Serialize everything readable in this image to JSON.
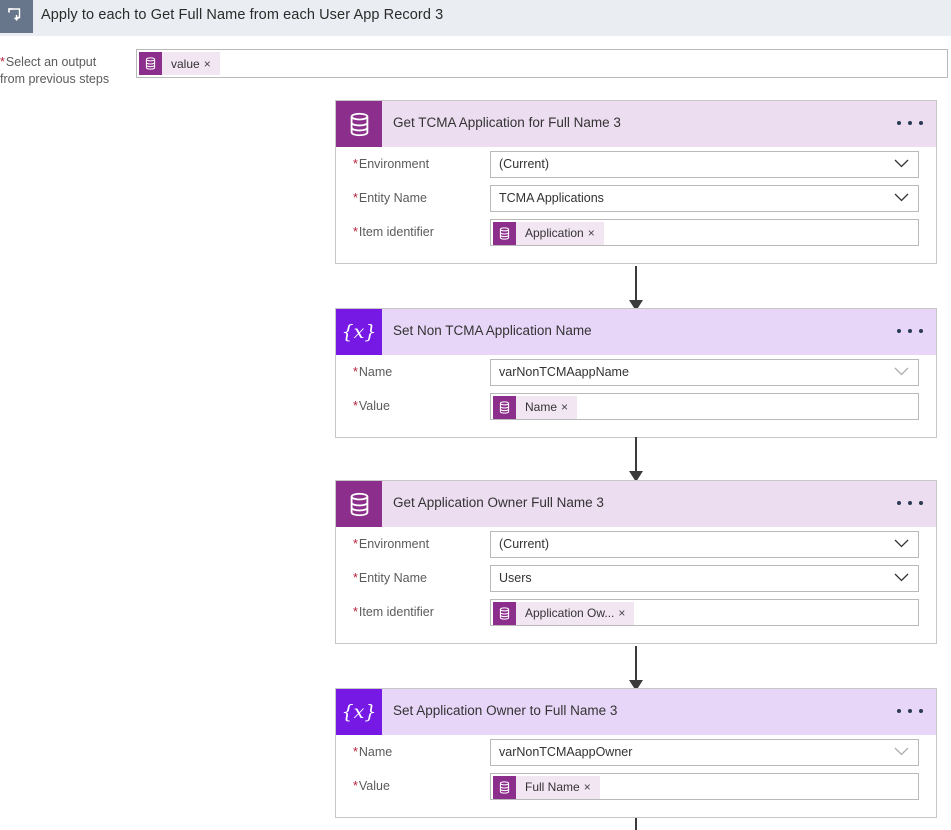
{
  "header": {
    "icon": "loop-repeat-icon",
    "title": "Apply to each to Get Full Name from each User App Record 3"
  },
  "output_selector": {
    "label_line1": "Select an output",
    "label_line2": "from previous steps",
    "required_mark": "*",
    "token": {
      "text": "value",
      "remove": "×",
      "icon": "database-icon"
    }
  },
  "colors": {
    "header_bar": "#eaedf1",
    "header_tile": "#67768a",
    "action_header": "#ecddf0",
    "action_icon": "#8c2f8c",
    "variable_header": "#e7d6f8",
    "variable_icon": "#7719e5",
    "token_bg": "#f3e6f3",
    "required_asterisk": "#b4213a",
    "menu_dots": "#2b3a55",
    "arrow": "#3b3b3b"
  },
  "cards": [
    {
      "title": "Get TCMA Application for Full Name 3",
      "icon": "database-icon",
      "type": "action",
      "menu": "more-options",
      "rows": [
        {
          "label": "Environment",
          "required": "*",
          "kind": "dropdown",
          "value": "(Current)"
        },
        {
          "label": "Entity Name",
          "required": "*",
          "kind": "dropdown",
          "value": "TCMA Applications"
        },
        {
          "label": "Item identifier",
          "required": "*",
          "kind": "token",
          "token": {
            "text": "Application",
            "remove": "×",
            "icon": "database-icon"
          }
        }
      ]
    },
    {
      "title": "Set Non TCMA Application Name",
      "icon": "variable-icon",
      "type": "variable",
      "menu": "more-options",
      "rows": [
        {
          "label": "Name",
          "required": "*",
          "kind": "dropdown-dim",
          "value": "varNonTCMAappName"
        },
        {
          "label": "Value",
          "required": "*",
          "kind": "token",
          "token": {
            "text": "Name",
            "remove": "×",
            "icon": "database-icon"
          }
        }
      ]
    },
    {
      "title": "Get Application Owner Full Name 3",
      "icon": "database-icon",
      "type": "action",
      "menu": "more-options",
      "rows": [
        {
          "label": "Environment",
          "required": "*",
          "kind": "dropdown",
          "value": "(Current)"
        },
        {
          "label": "Entity Name",
          "required": "*",
          "kind": "dropdown",
          "value": "Users"
        },
        {
          "label": "Item identifier",
          "required": "*",
          "kind": "token",
          "token": {
            "text": "Application Ow...",
            "remove": "×",
            "icon": "database-icon"
          }
        }
      ]
    },
    {
      "title": "Set Application Owner to Full Name 3",
      "icon": "variable-icon",
      "type": "variable",
      "menu": "more-options",
      "rows": [
        {
          "label": "Name",
          "required": "*",
          "kind": "dropdown-dim",
          "value": "varNonTCMAappOwner"
        },
        {
          "label": "Value",
          "required": "*",
          "kind": "token",
          "token": {
            "text": "Full Name",
            "remove": "×",
            "icon": "database-icon"
          }
        }
      ]
    }
  ]
}
